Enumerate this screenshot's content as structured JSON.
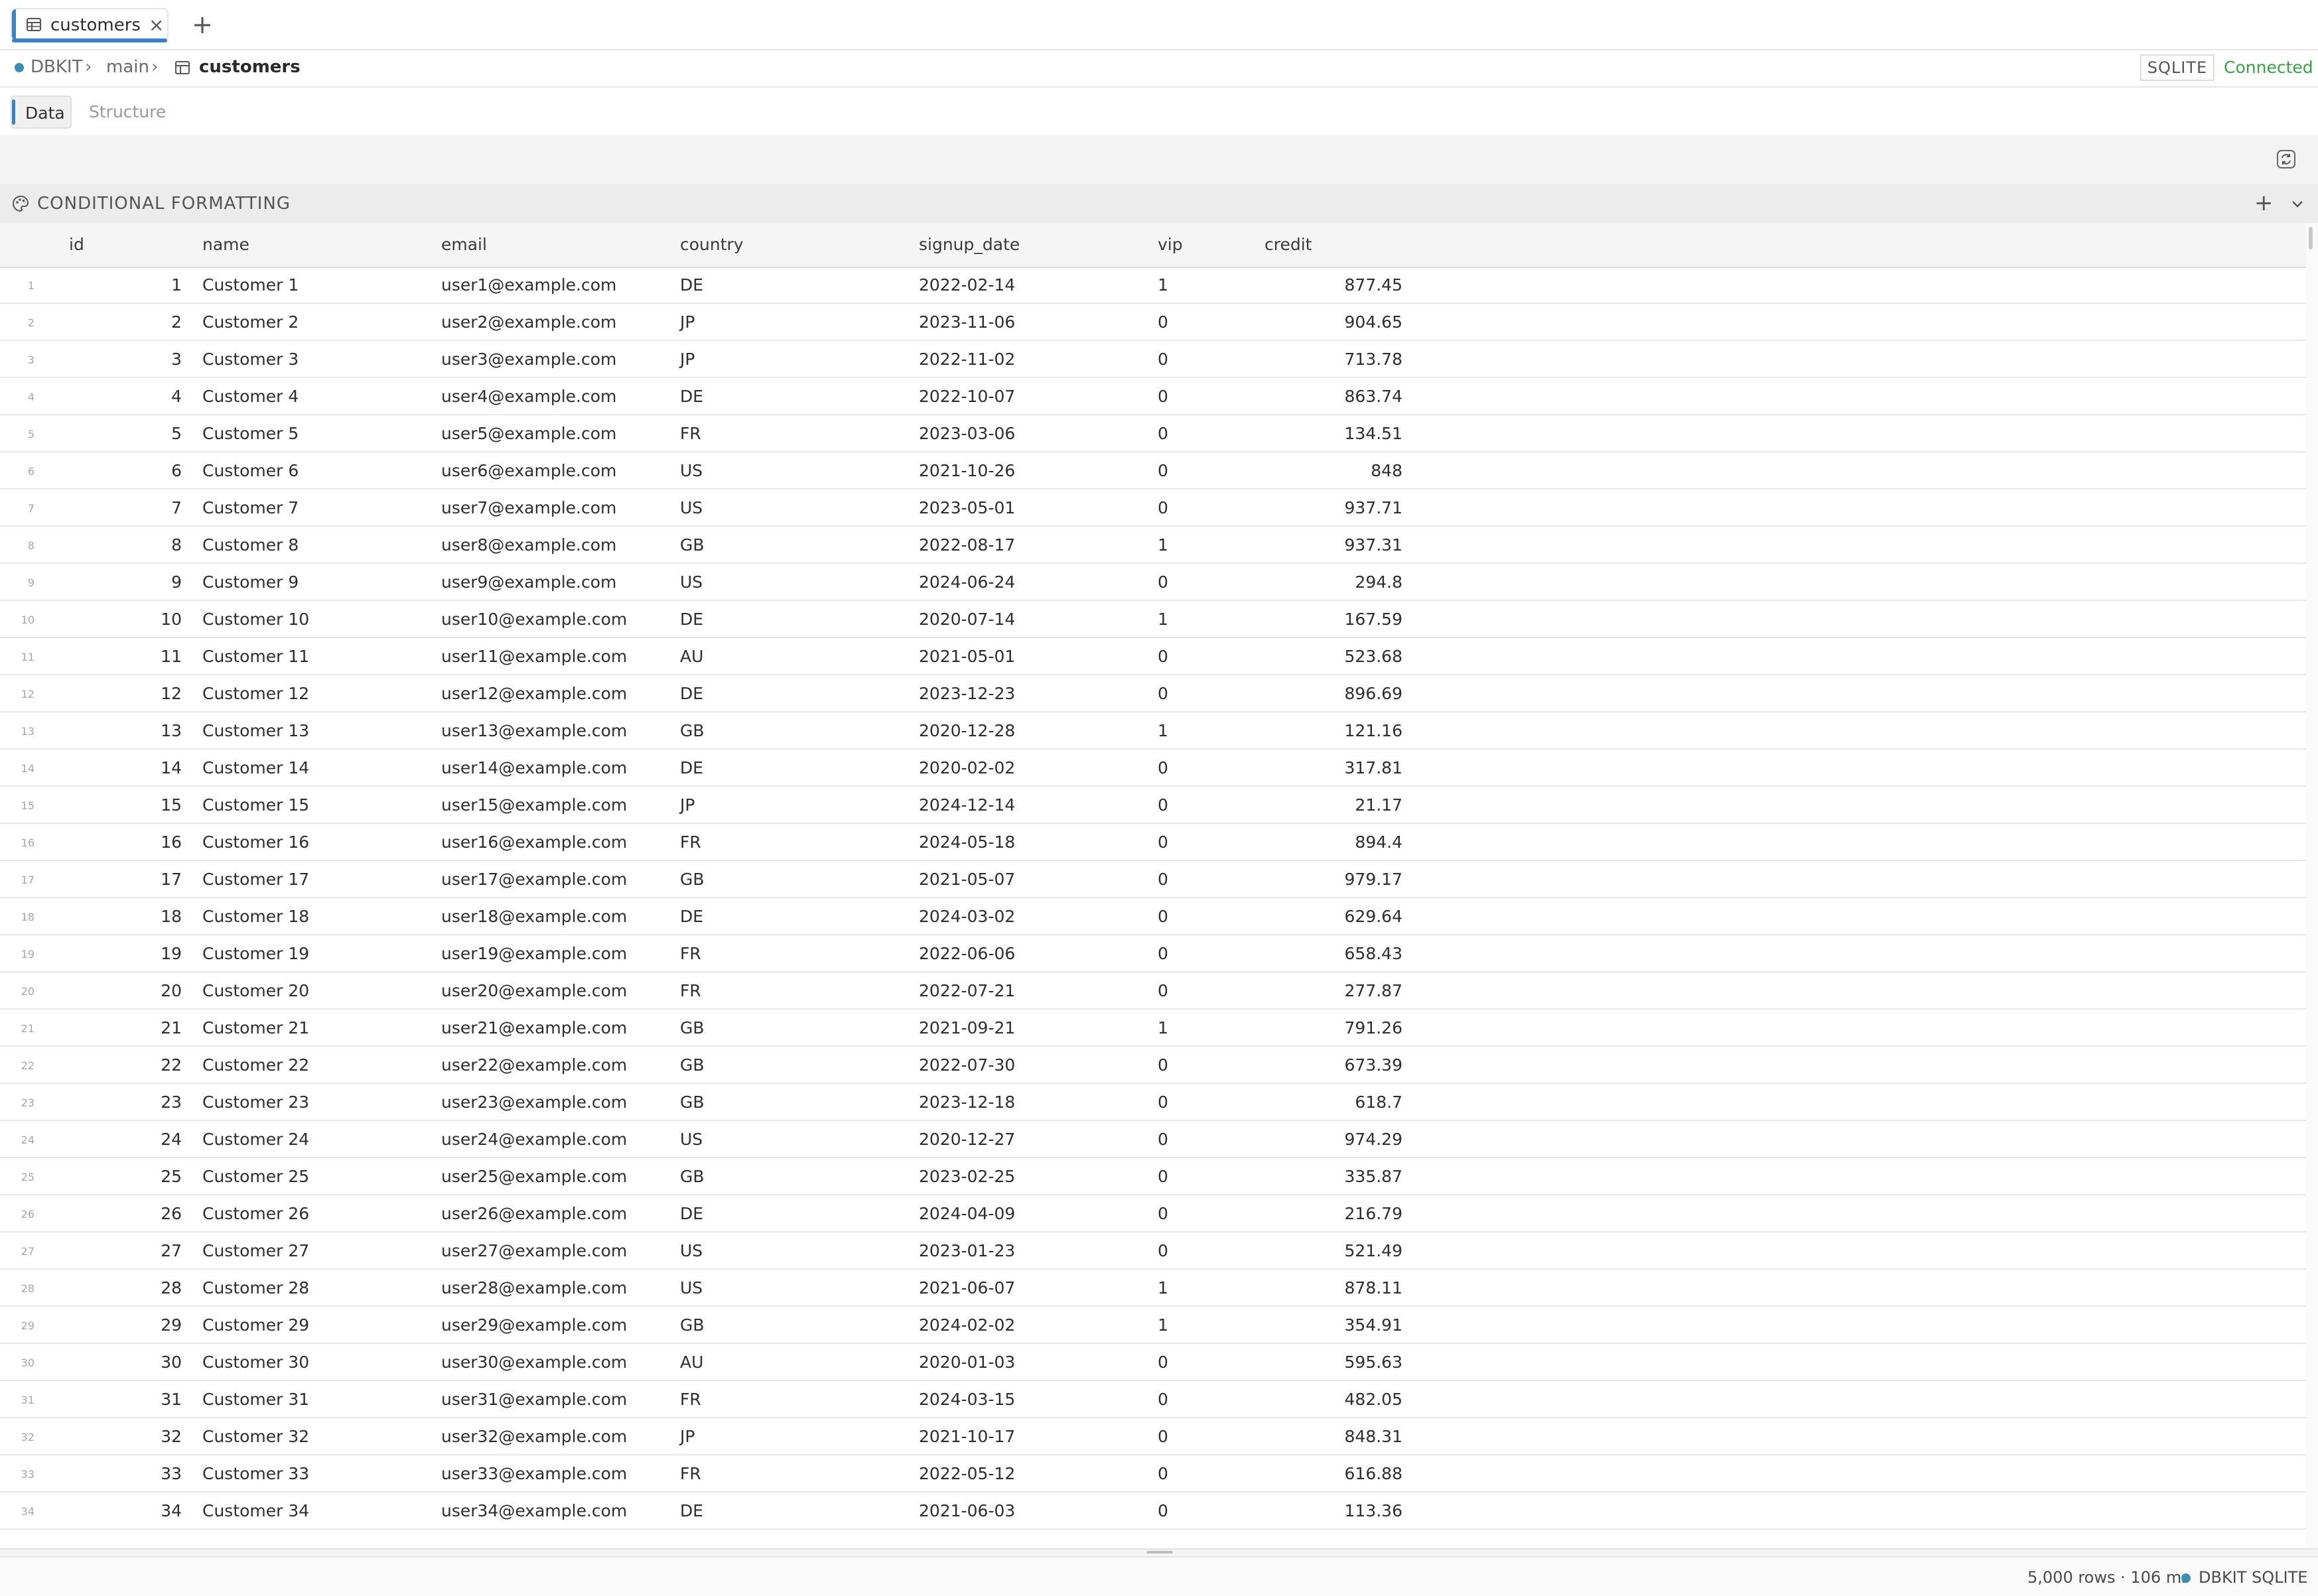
{
  "tab": {
    "label": "customers",
    "close": "×",
    "new_tab": "+"
  },
  "breadcrumb": {
    "connection": "DBKIT",
    "schema": "main",
    "table": "customers",
    "sep": "›"
  },
  "connection": {
    "engine": "SQLITE",
    "status": "Connected"
  },
  "view_tabs": {
    "data": "Data",
    "structure": "Structure"
  },
  "conditional_formatting": {
    "label": "CONDITIONAL FORMATTING",
    "add": "+"
  },
  "columns": {
    "id": "id",
    "name": "name",
    "email": "email",
    "country": "country",
    "signup_date": "signup_date",
    "vip": "vip",
    "credit": "credit"
  },
  "rows": [
    {
      "rn": "1",
      "id": "1",
      "name": "Customer 1",
      "email": "user1@example.com",
      "country": "DE",
      "signup_date": "2022-02-14",
      "vip": "1",
      "credit": "877.45"
    },
    {
      "rn": "2",
      "id": "2",
      "name": "Customer 2",
      "email": "user2@example.com",
      "country": "JP",
      "signup_date": "2023-11-06",
      "vip": "0",
      "credit": "904.65"
    },
    {
      "rn": "3",
      "id": "3",
      "name": "Customer 3",
      "email": "user3@example.com",
      "country": "JP",
      "signup_date": "2022-11-02",
      "vip": "0",
      "credit": "713.78"
    },
    {
      "rn": "4",
      "id": "4",
      "name": "Customer 4",
      "email": "user4@example.com",
      "country": "DE",
      "signup_date": "2022-10-07",
      "vip": "0",
      "credit": "863.74"
    },
    {
      "rn": "5",
      "id": "5",
      "name": "Customer 5",
      "email": "user5@example.com",
      "country": "FR",
      "signup_date": "2023-03-06",
      "vip": "0",
      "credit": "134.51"
    },
    {
      "rn": "6",
      "id": "6",
      "name": "Customer 6",
      "email": "user6@example.com",
      "country": "US",
      "signup_date": "2021-10-26",
      "vip": "0",
      "credit": "848"
    },
    {
      "rn": "7",
      "id": "7",
      "name": "Customer 7",
      "email": "user7@example.com",
      "country": "US",
      "signup_date": "2023-05-01",
      "vip": "0",
      "credit": "937.71"
    },
    {
      "rn": "8",
      "id": "8",
      "name": "Customer 8",
      "email": "user8@example.com",
      "country": "GB",
      "signup_date": "2022-08-17",
      "vip": "1",
      "credit": "937.31"
    },
    {
      "rn": "9",
      "id": "9",
      "name": "Customer 9",
      "email": "user9@example.com",
      "country": "US",
      "signup_date": "2024-06-24",
      "vip": "0",
      "credit": "294.8"
    },
    {
      "rn": "10",
      "id": "10",
      "name": "Customer 10",
      "email": "user10@example.com",
      "country": "DE",
      "signup_date": "2020-07-14",
      "vip": "1",
      "credit": "167.59"
    },
    {
      "rn": "11",
      "id": "11",
      "name": "Customer 11",
      "email": "user11@example.com",
      "country": "AU",
      "signup_date": "2021-05-01",
      "vip": "0",
      "credit": "523.68"
    },
    {
      "rn": "12",
      "id": "12",
      "name": "Customer 12",
      "email": "user12@example.com",
      "country": "DE",
      "signup_date": "2023-12-23",
      "vip": "0",
      "credit": "896.69"
    },
    {
      "rn": "13",
      "id": "13",
      "name": "Customer 13",
      "email": "user13@example.com",
      "country": "GB",
      "signup_date": "2020-12-28",
      "vip": "1",
      "credit": "121.16"
    },
    {
      "rn": "14",
      "id": "14",
      "name": "Customer 14",
      "email": "user14@example.com",
      "country": "DE",
      "signup_date": "2020-02-02",
      "vip": "0",
      "credit": "317.81"
    },
    {
      "rn": "15",
      "id": "15",
      "name": "Customer 15",
      "email": "user15@example.com",
      "country": "JP",
      "signup_date": "2024-12-14",
      "vip": "0",
      "credit": "21.17"
    },
    {
      "rn": "16",
      "id": "16",
      "name": "Customer 16",
      "email": "user16@example.com",
      "country": "FR",
      "signup_date": "2024-05-18",
      "vip": "0",
      "credit": "894.4"
    },
    {
      "rn": "17",
      "id": "17",
      "name": "Customer 17",
      "email": "user17@example.com",
      "country": "GB",
      "signup_date": "2021-05-07",
      "vip": "0",
      "credit": "979.17"
    },
    {
      "rn": "18",
      "id": "18",
      "name": "Customer 18",
      "email": "user18@example.com",
      "country": "DE",
      "signup_date": "2024-03-02",
      "vip": "0",
      "credit": "629.64"
    },
    {
      "rn": "19",
      "id": "19",
      "name": "Customer 19",
      "email": "user19@example.com",
      "country": "FR",
      "signup_date": "2022-06-06",
      "vip": "0",
      "credit": "658.43"
    },
    {
      "rn": "20",
      "id": "20",
      "name": "Customer 20",
      "email": "user20@example.com",
      "country": "FR",
      "signup_date": "2022-07-21",
      "vip": "0",
      "credit": "277.87"
    },
    {
      "rn": "21",
      "id": "21",
      "name": "Customer 21",
      "email": "user21@example.com",
      "country": "GB",
      "signup_date": "2021-09-21",
      "vip": "1",
      "credit": "791.26"
    },
    {
      "rn": "22",
      "id": "22",
      "name": "Customer 22",
      "email": "user22@example.com",
      "country": "GB",
      "signup_date": "2022-07-30",
      "vip": "0",
      "credit": "673.39"
    },
    {
      "rn": "23",
      "id": "23",
      "name": "Customer 23",
      "email": "user23@example.com",
      "country": "GB",
      "signup_date": "2023-12-18",
      "vip": "0",
      "credit": "618.7"
    },
    {
      "rn": "24",
      "id": "24",
      "name": "Customer 24",
      "email": "user24@example.com",
      "country": "US",
      "signup_date": "2020-12-27",
      "vip": "0",
      "credit": "974.29"
    },
    {
      "rn": "25",
      "id": "25",
      "name": "Customer 25",
      "email": "user25@example.com",
      "country": "GB",
      "signup_date": "2023-02-25",
      "vip": "0",
      "credit": "335.87"
    },
    {
      "rn": "26",
      "id": "26",
      "name": "Customer 26",
      "email": "user26@example.com",
      "country": "DE",
      "signup_date": "2024-04-09",
      "vip": "0",
      "credit": "216.79"
    },
    {
      "rn": "27",
      "id": "27",
      "name": "Customer 27",
      "email": "user27@example.com",
      "country": "US",
      "signup_date": "2023-01-23",
      "vip": "0",
      "credit": "521.49"
    },
    {
      "rn": "28",
      "id": "28",
      "name": "Customer 28",
      "email": "user28@example.com",
      "country": "US",
      "signup_date": "2021-06-07",
      "vip": "1",
      "credit": "878.11"
    },
    {
      "rn": "29",
      "id": "29",
      "name": "Customer 29",
      "email": "user29@example.com",
      "country": "GB",
      "signup_date": "2024-02-02",
      "vip": "1",
      "credit": "354.91"
    },
    {
      "rn": "30",
      "id": "30",
      "name": "Customer 30",
      "email": "user30@example.com",
      "country": "AU",
      "signup_date": "2020-01-03",
      "vip": "0",
      "credit": "595.63"
    },
    {
      "rn": "31",
      "id": "31",
      "name": "Customer 31",
      "email": "user31@example.com",
      "country": "FR",
      "signup_date": "2024-03-15",
      "vip": "0",
      "credit": "482.05"
    },
    {
      "rn": "32",
      "id": "32",
      "name": "Customer 32",
      "email": "user32@example.com",
      "country": "JP",
      "signup_date": "2021-10-17",
      "vip": "0",
      "credit": "848.31"
    },
    {
      "rn": "33",
      "id": "33",
      "name": "Customer 33",
      "email": "user33@example.com",
      "country": "FR",
      "signup_date": "2022-05-12",
      "vip": "0",
      "credit": "616.88"
    },
    {
      "rn": "34",
      "id": "34",
      "name": "Customer 34",
      "email": "user34@example.com",
      "country": "DE",
      "signup_date": "2021-06-03",
      "vip": "0",
      "credit": "113.36"
    }
  ],
  "status": {
    "rows_time": "5,000 rows · 106 ms",
    "connection": "DBKIT",
    "engine": "SQLITE"
  },
  "colors": {
    "accent": "#3b82c4",
    "connected": "#3aa046",
    "status_dot": "#3a8fae"
  },
  "icons": {
    "tab": "table-icon",
    "refresh": "refresh-icon",
    "palette": "palette-icon",
    "collapse": "chevron-down-icon"
  }
}
